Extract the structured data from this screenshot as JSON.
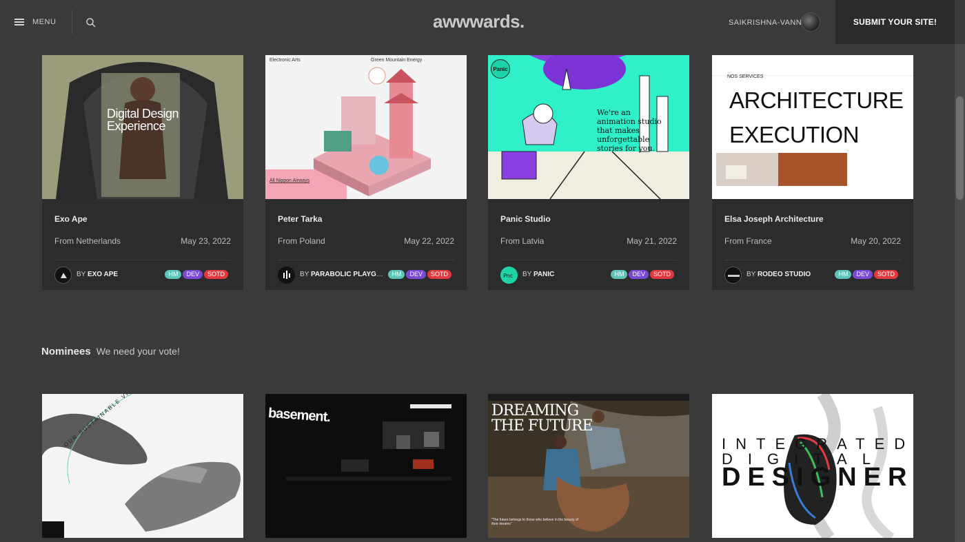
{
  "header": {
    "menu_label": "MENU",
    "logo": "awwwards.",
    "username": "SAIKRISHNA-VANN",
    "submit_label": "SUBMIT YOUR SITE!"
  },
  "cards": [
    {
      "title": "Exo Ape",
      "from": "From Netherlands",
      "date": "May 23, 2022",
      "by_prefix": "BY",
      "by": "EXO APE",
      "tags": [
        "HM",
        "DEV",
        "SOTD"
      ],
      "thumb_text": "Digital Design Experience"
    },
    {
      "title": "Peter Tarka",
      "from": "From Poland",
      "date": "May 22, 2022",
      "by_prefix": "BY",
      "by": "PARABOLIC PLAYGR...",
      "tags": [
        "HM",
        "DEV",
        "SOTD"
      ],
      "thumb_left": "Electronic Arts",
      "thumb_center": "Green Mountain Energy",
      "thumb_bottom": "All Nippon Airways"
    },
    {
      "title": "Panic Studio",
      "from": "From Latvia",
      "date": "May 21, 2022",
      "by_prefix": "BY",
      "by": "PANIC",
      "tags": [
        "HM",
        "DEV",
        "SOTD"
      ],
      "thumb_text": "We're an animation studio that makes unforgettable stories for you.",
      "thumb_logo": "Panic"
    },
    {
      "title": "Elsa Joseph Architecture",
      "from": "From France",
      "date": "May 20, 2022",
      "by_prefix": "BY",
      "by": "RODEO STUDIO",
      "tags": [
        "HM",
        "DEV",
        "SOTD"
      ],
      "thumb_small": "NOS SERVICES",
      "thumb_line1": "ARCHITECTURE",
      "thumb_line2": "EXECUTION"
    }
  ],
  "nominees": {
    "title": "Nominees",
    "subtitle": "We need your vote!",
    "items": [
      {
        "text": "OUR SUSTAINABLE VISION"
      },
      {
        "text": "basement."
      },
      {
        "text1": "DREAMING",
        "text2": "THE FUTURE",
        "quote": "\"The future belongs to those who believe in the beauty of their dreams\""
      },
      {
        "line1": "INTEGRATED",
        "line2": "DIGITAL",
        "line3": "DESIGNER"
      }
    ]
  },
  "colors": {
    "background": "#3a3a3a",
    "card": "#2c2c2c",
    "hm": "#5cc4b9",
    "dev": "#7a4ad7",
    "sotd": "#e2393f"
  }
}
